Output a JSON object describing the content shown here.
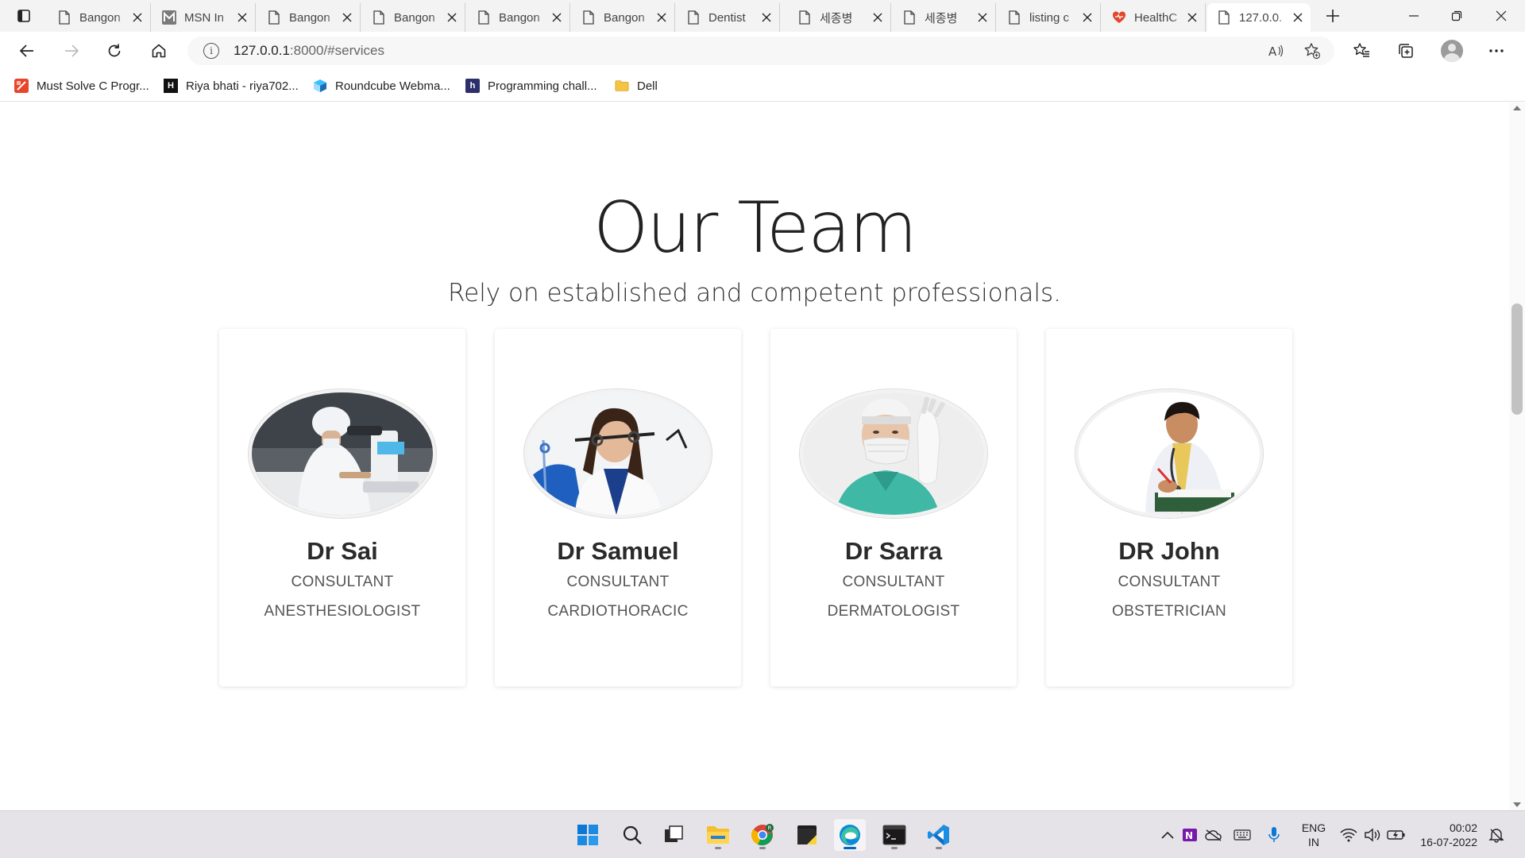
{
  "browser": {
    "tabs": [
      {
        "label": "Bangon",
        "icon": "page-icon"
      },
      {
        "label": "MSN In",
        "icon": "msn-icon"
      },
      {
        "label": "Bangon",
        "icon": "page-icon"
      },
      {
        "label": "Bangon",
        "icon": "page-icon"
      },
      {
        "label": "Bangon",
        "icon": "page-icon"
      },
      {
        "label": "Bangon",
        "icon": "page-icon"
      },
      {
        "label": "Dentist",
        "icon": "page-icon"
      },
      {
        "label": "세종병",
        "icon": "page-icon"
      },
      {
        "label": "세종병",
        "icon": "page-icon"
      },
      {
        "label": "listing c",
        "icon": "page-icon"
      },
      {
        "label": "HealthC",
        "icon": "heart-icon"
      },
      {
        "label": "127.0.0.",
        "icon": "page-icon",
        "active": true
      }
    ],
    "address": {
      "host": "127.0.0.1",
      "rest": ":8000/#services"
    },
    "bookmarks": [
      {
        "label": "Must Solve C Progr...",
        "icon": "red-bookmark-icon"
      },
      {
        "label": "Riya bhati - riya702...",
        "icon": "hackerrank-icon"
      },
      {
        "label": "Roundcube Webma...",
        "icon": "roundcube-icon"
      },
      {
        "label": "Programming chall...",
        "icon": "h-icon"
      },
      {
        "label": "Dell",
        "icon": "folder-icon"
      }
    ]
  },
  "page": {
    "title": "Our Team",
    "subtitle": "Rely on established and competent professionals.",
    "team": [
      {
        "name": "Dr Sai",
        "role": "CONSULTANT",
        "specialty": "ANESTHESIOLOGIST",
        "photo": "microscope-doctor-photo"
      },
      {
        "name": "Dr Samuel",
        "role": "CONSULTANT",
        "specialty": "CARDIOTHORACIC",
        "photo": "stethoscope-doctor-photo"
      },
      {
        "name": "Dr Sarra",
        "role": "CONSULTANT",
        "specialty": "DERMATOLOGIST",
        "photo": "surgeon-mask-photo"
      },
      {
        "name": "DR John",
        "role": "CONSULTANT",
        "specialty": "OBSTETRICIAN",
        "photo": "writing-doctor-photo"
      }
    ]
  },
  "taskbar": {
    "language": {
      "line1": "ENG",
      "line2": "IN"
    },
    "clock": {
      "time": "00:02",
      "date": "16-07-2022"
    }
  },
  "colors": {
    "accent": "#0067c0",
    "taskbar": "#e6e3e8",
    "tab_strip": "#f3f3f3"
  }
}
